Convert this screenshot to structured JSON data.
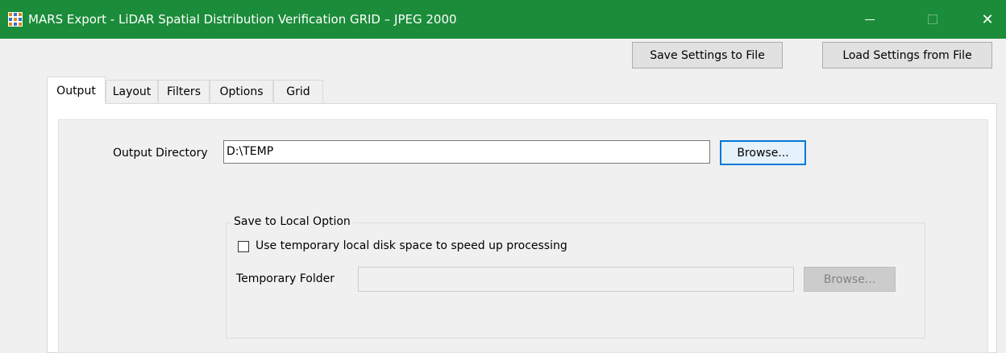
{
  "window": {
    "title": "MARS Export - LiDAR Spatial Distribution Verification GRID – JPEG 2000",
    "icon": "app-grid-icon",
    "controls": {
      "minimize_icon": "minimize-icon",
      "maximize_icon": "maximize-icon",
      "close_icon": "close-icon",
      "close_glyph": "✕"
    },
    "titlebar_color": "#1b8c3a"
  },
  "toolbar": {
    "save_label": "Save Settings to File",
    "load_label": "Load Settings from File"
  },
  "tabs": [
    {
      "label": "Output",
      "active": true
    },
    {
      "label": "Layout",
      "active": false
    },
    {
      "label": "Filters",
      "active": false
    },
    {
      "label": "Options",
      "active": false
    },
    {
      "label": "Grid",
      "active": false
    }
  ],
  "output": {
    "directory_label": "Output Directory",
    "directory_value": "D:\\TEMP",
    "browse_label": "Browse...",
    "local": {
      "group_title": "Save to Local Option",
      "checkbox_label": "Use temporary local disk space to speed up processing",
      "checkbox_checked": false,
      "temp_folder_label": "Temporary Folder",
      "temp_folder_value": "",
      "browse_label": "Browse...",
      "browse_enabled": false
    }
  },
  "colors": {
    "accent_focus": "#0078d7",
    "disabled_text": "#838383"
  }
}
